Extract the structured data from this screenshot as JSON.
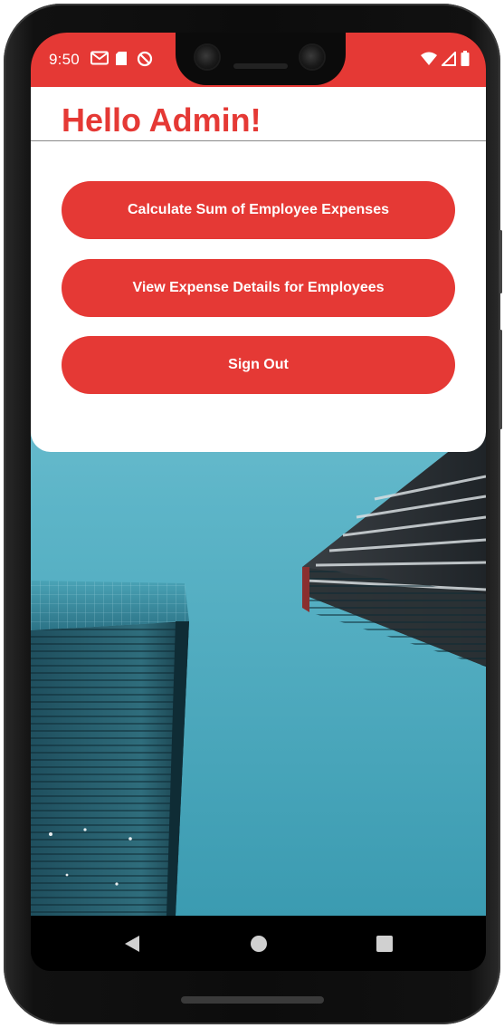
{
  "status_bar": {
    "time": "9:50",
    "left_icons": [
      "gmail-icon",
      "sd-card-icon",
      "do-not-disturb-icon"
    ],
    "right_icons": [
      "wifi-icon",
      "signal-icon",
      "battery-icon"
    ],
    "color": "#e53935"
  },
  "header": {
    "title": "Hello Admin!"
  },
  "actions": {
    "calculate_sum_label": "Calculate Sum of Employee Expenses",
    "view_details_label": "View Expense Details for Employees",
    "sign_out_label": "Sign Out"
  },
  "navigation_bar": {
    "buttons": [
      "back-icon",
      "home-icon",
      "recents-icon"
    ]
  },
  "theme": {
    "accent": "#e53935",
    "card": "#ffffff"
  }
}
